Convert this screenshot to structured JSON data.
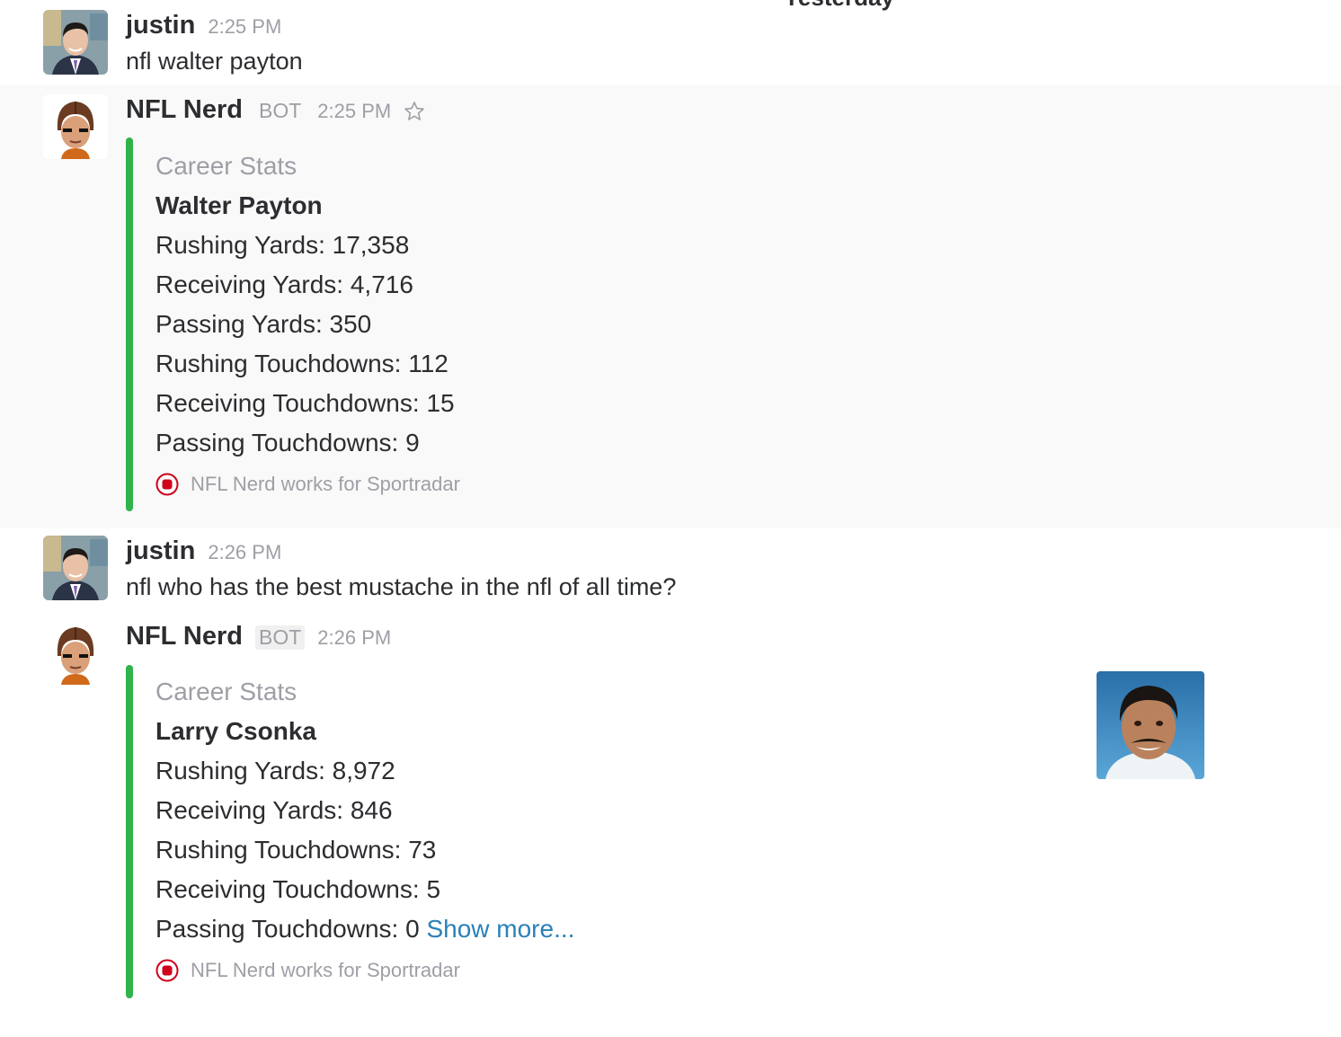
{
  "day_divider": "Yesterday",
  "messages": [
    {
      "sender": "justin",
      "time": "2:25 PM",
      "text": "nfl walter payton",
      "avatar_icon": "user-avatar-icon"
    },
    {
      "sender": "NFL Nerd",
      "badge": "BOT",
      "time": "2:25 PM",
      "avatar_icon": "bot-helmet-avatar-icon",
      "attachment": {
        "pretext": "Career Stats",
        "title": "Walter Payton",
        "fields": [
          "Rushing Yards: 17,358",
          "Receiving Yards: 4,716",
          "Passing Yards: 350",
          "Rushing Touchdowns: 112",
          "Receiving Touchdowns: 15",
          "Passing Touchdowns: 9"
        ],
        "footer": "NFL Nerd works for Sportradar",
        "bar_color": "#2fb34a"
      }
    },
    {
      "sender": "justin",
      "time": "2:26 PM",
      "text": "nfl who has the best mustache in the nfl of all time?",
      "avatar_icon": "user-avatar-icon"
    },
    {
      "sender": "NFL Nerd",
      "badge": "BOT",
      "time": "2:26 PM",
      "avatar_icon": "bot-helmet-avatar-icon",
      "attachment": {
        "pretext": "Career Stats",
        "title": "Larry Csonka",
        "fields": [
          "Rushing Yards: 8,972",
          "Receiving Yards: 846",
          "Rushing Touchdowns: 73",
          "Receiving Touchdowns: 5",
          "Passing Touchdowns: 0"
        ],
        "show_more": "Show more...",
        "footer": "NFL Nerd works for Sportradar",
        "bar_color": "#2fb34a",
        "thumbnail": "player-photo"
      }
    }
  ],
  "colors": {
    "accent_link": "#2a80b9",
    "attachment_bar": "#2fb34a",
    "footer_icon": "#d0021b",
    "muted": "#9e9ea6"
  }
}
